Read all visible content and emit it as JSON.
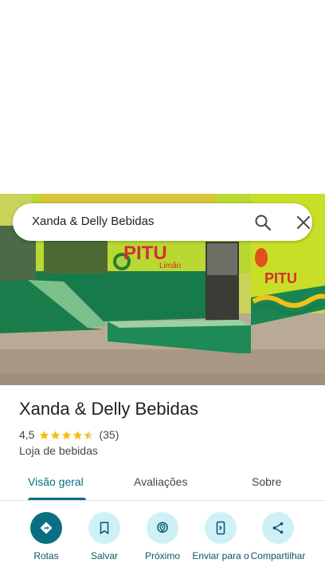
{
  "search": {
    "query": "Xanda & Delly Bebidas"
  },
  "photo": {
    "sign_text": "PITU",
    "sign_sub": "Limão"
  },
  "place": {
    "name": "Xanda & Delly Bebidas",
    "rating": "4,5",
    "stars": 4.5,
    "review_count": "(35)",
    "category": "Loja de bebidas"
  },
  "tabs": [
    {
      "label": "Visão geral",
      "active": true
    },
    {
      "label": "Avaliações",
      "active": false
    },
    {
      "label": "Sobre",
      "active": false
    }
  ],
  "actions": [
    {
      "label": "Rotas",
      "icon": "directions-icon"
    },
    {
      "label": "Salvar",
      "icon": "bookmark-icon"
    },
    {
      "label": "Próximo",
      "icon": "nearby-icon"
    },
    {
      "label": "Enviar para o",
      "icon": "send-to-phone-icon"
    },
    {
      "label": "Compartilhar",
      "icon": "share-icon"
    }
  ],
  "colors": {
    "accent": "#0b6f83",
    "accent_light": "#cdf1f7",
    "star": "#fbbc04"
  }
}
